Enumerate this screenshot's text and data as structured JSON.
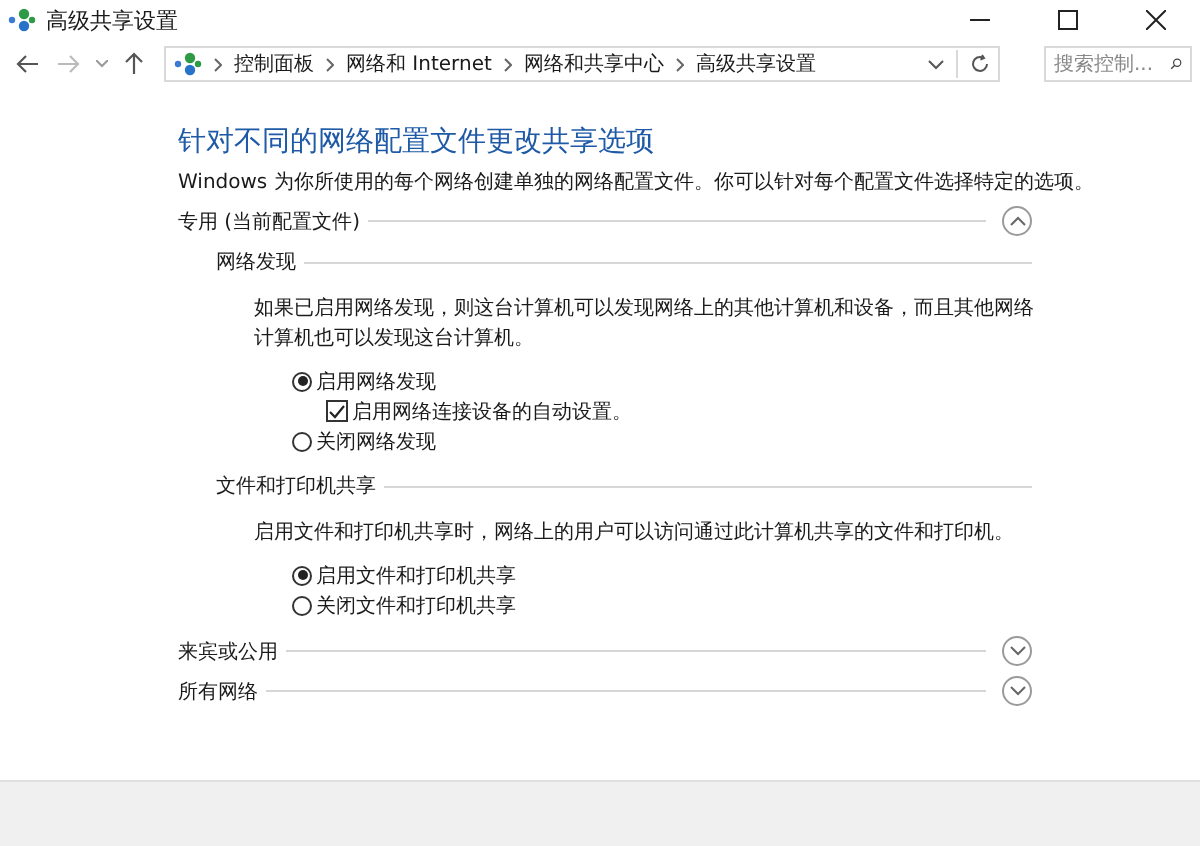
{
  "window": {
    "title": "高级共享设置"
  },
  "address_bar": {
    "breadcrumb": [
      "控制面板",
      "网络和 Internet",
      "网络和共享中心",
      "高级共享设置"
    ],
    "search": {
      "placeholder": "搜索控制..."
    }
  },
  "heading": "针对不同的网络配置文件更改共享选项",
  "description": "Windows 为你所使用的每个网络创建单独的网络配置文件。你可以针对每个配置文件选择特定的选项。",
  "profiles": [
    {
      "title": "专用 (当前配置文件)",
      "expanded": true,
      "groups": [
        {
          "title": "网络发现",
          "description": "如果已启用网络发现，则这台计算机可以发现网络上的其他计算机和设备，而且其他网络计算机也可以发现这台计算机。",
          "options": [
            {
              "kind": "radio",
              "label": "启用网络发现",
              "selected": true,
              "children": [
                {
                  "kind": "checkbox",
                  "label": "启用网络连接设备的自动设置。",
                  "checked": true
                }
              ]
            },
            {
              "kind": "radio",
              "label": "关闭网络发现",
              "selected": false
            }
          ]
        },
        {
          "title": "文件和打印机共享",
          "description": "启用文件和打印机共享时，网络上的用户可以访问通过此计算机共享的文件和打印机。",
          "options": [
            {
              "kind": "radio",
              "label": "启用文件和打印机共享",
              "selected": true
            },
            {
              "kind": "radio",
              "label": "关闭文件和打印机共享",
              "selected": false
            }
          ]
        }
      ]
    },
    {
      "title": "来宾或公用",
      "expanded": false
    },
    {
      "title": "所有网络",
      "expanded": false
    }
  ]
}
